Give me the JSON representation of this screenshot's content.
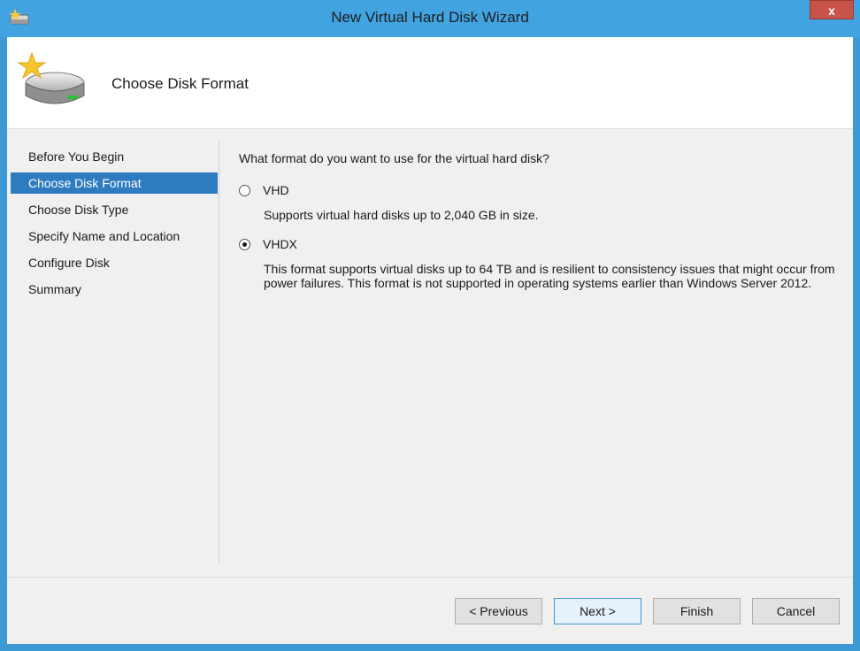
{
  "window": {
    "title": "New Virtual Hard Disk Wizard",
    "close_label": "x"
  },
  "header": {
    "title": "Choose Disk Format"
  },
  "nav": {
    "items": [
      {
        "label": "Before You Begin"
      },
      {
        "label": "Choose Disk Format",
        "selected": true
      },
      {
        "label": "Choose Disk Type"
      },
      {
        "label": "Specify Name and Location"
      },
      {
        "label": "Configure Disk"
      },
      {
        "label": "Summary"
      }
    ]
  },
  "content": {
    "question": "What format do you want to use for the virtual hard disk?",
    "options": [
      {
        "label": "VHD",
        "checked": false,
        "description": "Supports virtual hard disks up to 2,040 GB in size."
      },
      {
        "label": "VHDX",
        "checked": true,
        "description": "This format supports virtual disks up to 64 TB and is resilient to consistency issues that might occur from power failures. This format is not supported in operating systems earlier than Windows Server 2012."
      }
    ]
  },
  "buttons": {
    "previous": "< Previous",
    "next": "Next >",
    "finish": "Finish",
    "cancel": "Cancel"
  },
  "colors": {
    "titlebar": "#41a3e0",
    "selection": "#2f7bbf",
    "close": "#c7534a"
  }
}
